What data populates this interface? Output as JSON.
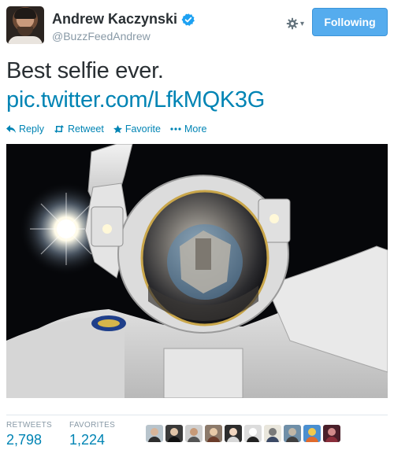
{
  "profile": {
    "name": "Andrew Kaczynski",
    "screen_name": "@BuzzFeedAndrew",
    "verified": true
  },
  "header": {
    "follow_label": "Following",
    "gear_icon": "gear-icon",
    "caret_icon": "chevron-down-icon"
  },
  "tweet": {
    "text": "Best selfie ever.",
    "link": "pic.twitter.com/LfkMQK3G"
  },
  "actions": [
    {
      "label": "Reply",
      "icon": "reply-icon"
    },
    {
      "label": "Retweet",
      "icon": "retweet-icon"
    },
    {
      "label": "Favorite",
      "icon": "star-icon"
    },
    {
      "label": "More",
      "icon": "more-icon"
    }
  ],
  "stats": {
    "retweets_label": "RETWEETS",
    "retweets_value": "2,798",
    "favorites_label": "FAVORITES",
    "favorites_value": "1,224"
  },
  "favoriters": [
    {
      "bg": "#b8c4cc",
      "face": "#d8b59a",
      "body": "#2e2e2e"
    },
    {
      "bg": "#3a3a3a",
      "face": "#e0c4a8",
      "body": "#111111"
    },
    {
      "bg": "#cfcfcf",
      "face": "#c79a78",
      "body": "#555555"
    },
    {
      "bg": "#8c7a6b",
      "face": "#e7caa8",
      "body": "#6b3d2b"
    },
    {
      "bg": "#2d2d2d",
      "face": "#f1d6c0",
      "body": "#d8d8d8"
    },
    {
      "bg": "#dcdcdc",
      "face": "#ffffff",
      "body": "#222222"
    },
    {
      "bg": "#e9e6dc",
      "face": "#7a7a7a",
      "body": "#3c4a66"
    },
    {
      "bg": "#6f8fa8",
      "face": "#c0b6a6",
      "body": "#404040"
    },
    {
      "bg": "#4a8fd0",
      "face": "#f2c94c",
      "body": "#e06b2c"
    },
    {
      "bg": "#4a1f2a",
      "face": "#d28b8b",
      "body": "#8a2e3a"
    }
  ],
  "colors": {
    "link": "#0084b4",
    "follow_button": "#55acee",
    "verified": "#1da1f2"
  }
}
